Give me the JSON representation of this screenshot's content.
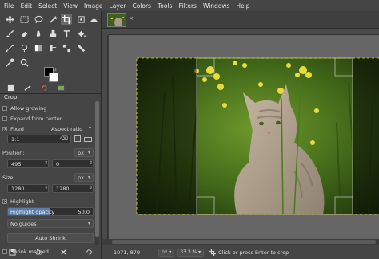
{
  "menubar": [
    "File",
    "Edit",
    "Select",
    "View",
    "Image",
    "Layer",
    "Colors",
    "Tools",
    "Filters",
    "Windows",
    "Help"
  ],
  "dock": {
    "panel_title": "Crop",
    "options": {
      "allow_growing": "Allow growing",
      "expand_from_center": "Expand from center",
      "fixed_label": "Fixed",
      "fixed_mode": "Aspect ratio",
      "ratio_value": "1:1",
      "position_label": "Position:",
      "position_unit": "px",
      "position_x": "495",
      "position_y": "0",
      "size_label": "Size:",
      "size_unit": "px",
      "size_w": "1280",
      "size_h": "1280",
      "highlight_label": "Highlight",
      "highlight_opacity_label": "Highlight opacity",
      "highlight_opacity_value": "50.0",
      "highlight_opacity_fraction": 0.5,
      "guides": "No guides",
      "auto_shrink": "Auto Shrink",
      "shrink_merged": "Shrink merged"
    }
  },
  "statusbar": {
    "coords": "1071, 879",
    "unit": "px",
    "zoom": "33.3 %",
    "message": "Click or press Enter to crop"
  },
  "colors": {
    "canvas_bg": "#666666",
    "fg": "#000000",
    "bg": "#ffffff"
  }
}
